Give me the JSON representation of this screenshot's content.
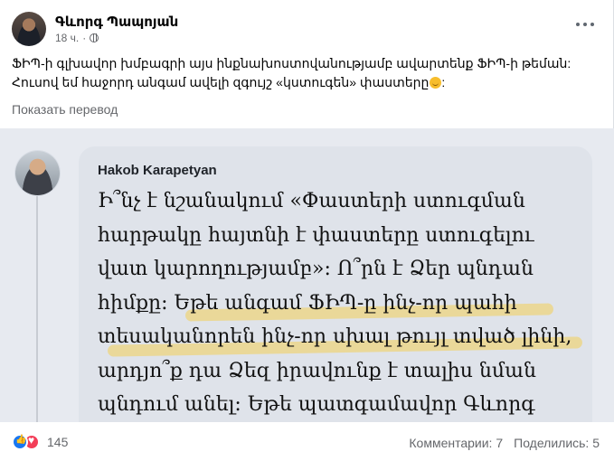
{
  "post": {
    "author": "Գևորգ Պապոյան",
    "time": "18 ч.",
    "text": "ՖԻՊ-ի գլխավոր խմբագրի այս ինքնախոստովանությամբ ավարտենք ՖԻՊ-ի թեման: Հուսով եմ հաջորդ անգամ ավելի զգույշ «կստուգեն» փաստերը",
    "translate": "Показать перевод"
  },
  "comment": {
    "author": "Hakob Karapetyan",
    "text": "Ի՞նչ է նշանակում «Փաստերի ստուգման\nհարթակը հայտնի է փաստերը ստուգելու\nվատ կարողությամբ»: Ո՞րն է Ձեր պնդան\nհիմքը: Եթե անգամ ՖԻՊ-ը ինչ-որ պահի\nտեսականորեն ինչ-որ սխալ թույլ տված լինի,\nարդյո՞ք դա Ձեզ իրավունք է տալիս նման\nպնդում անել: Եթե պատգամավոր Գևորգ"
  },
  "footer": {
    "reactions": "145",
    "comments": "Комментарии: 7",
    "shares": "Поделились: 5"
  },
  "colors": {
    "highlight": "#f2cf56",
    "reaction_like": "#1877f2",
    "reaction_love": "#f33e58"
  },
  "icons": [
    "globe-icon",
    "more-icon",
    "like-icon",
    "love-icon",
    "smile-emoji-icon"
  ]
}
